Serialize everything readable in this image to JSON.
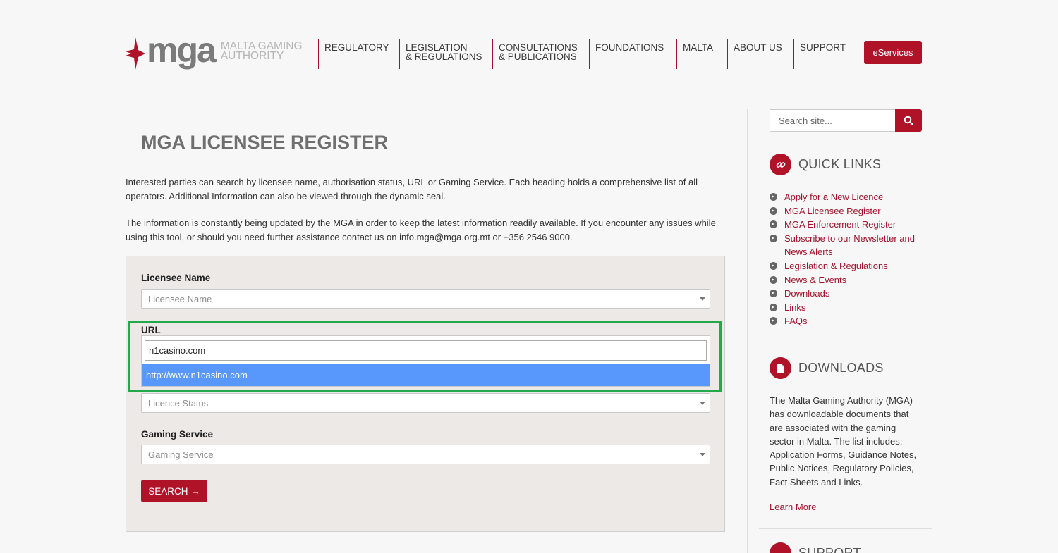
{
  "header": {
    "logo_word": "mga",
    "logo_sub_line1": "MALTA GAMING",
    "logo_sub_line2": "AUTHORITY",
    "nav": [
      {
        "line1": "REGULATORY",
        "line2": ""
      },
      {
        "line1": "LEGISLATION",
        "line2": "& REGULATIONS"
      },
      {
        "line1": "CONSULTATIONS",
        "line2": "& PUBLICATIONS"
      },
      {
        "line1": "FOUNDATIONS",
        "line2": ""
      },
      {
        "line1": "MALTA",
        "line2": ""
      },
      {
        "line1": "ABOUT US",
        "line2": ""
      },
      {
        "line1": "SUPPORT",
        "line2": ""
      }
    ],
    "eservices": "eServices"
  },
  "main": {
    "title": "MGA LICENSEE REGISTER",
    "intro1": "Interested parties can search by licensee name, authorisation status, URL or Gaming Service. Each heading holds a comprehensive list of all operators. Additional Information can also be viewed through the dynamic seal.",
    "intro2": "The information is constantly being updated by the MGA in order to keep the latest information readily available. If you encounter any issues while using this tool, or should you need further assistance contact us on info.mga@mga.org.mt or +356 2546 9000.",
    "form": {
      "licensee_label": "Licensee Name",
      "licensee_placeholder": "Licensee Name",
      "url_label": "URL",
      "url_input_value": "n1casino.com",
      "url_option": "http://www.n1casino.com",
      "status_placeholder": "Licence Status",
      "gaming_label": "Gaming Service",
      "gaming_placeholder": "Gaming Service",
      "search_button": "SEARCH →"
    }
  },
  "sidebar": {
    "search_placeholder": "Search site...",
    "quick_links_title": "QUICK LINKS",
    "quick_links": [
      "Apply for a New Licence",
      "MGA Licensee Register",
      "MGA Enforcement Register",
      "Subscribe to our Newsletter and News Alerts",
      "Legislation & Regulations",
      "News & Events",
      "Downloads",
      "Links",
      "FAQs"
    ],
    "downloads_title": "DOWNLOADS",
    "downloads_text": "The Malta Gaming Authority (MGA) has downloadable documents that are associated with the gaming sector in Malta. The list includes; Application Forms, Guidance Notes, Public Notices, Regulatory Policies, Fact Sheets and Links.",
    "learn_more": "Learn More",
    "support_title": "SUPPORT"
  },
  "colors": {
    "brand_red": "#b01228",
    "highlight_green": "#23a84a",
    "option_blue": "#5897fb"
  }
}
